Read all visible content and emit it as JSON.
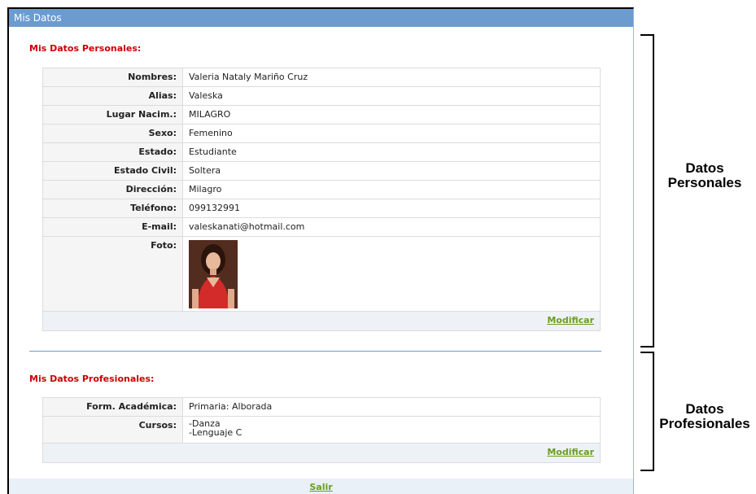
{
  "header": {
    "title": "Mis Datos"
  },
  "personal": {
    "title": "Mis Datos Personales:",
    "rows": [
      {
        "label": "Nombres:",
        "value": "Valeria Nataly Mariño Cruz"
      },
      {
        "label": "Alias:",
        "value": "Valeska"
      },
      {
        "label": "Lugar Nacim.:",
        "value": "MILAGRO"
      },
      {
        "label": "Sexo:",
        "value": "Femenino"
      },
      {
        "label": "Estado:",
        "value": "Estudiante"
      },
      {
        "label": "Estado Civil:",
        "value": "Soltera"
      },
      {
        "label": "Dirección:",
        "value": "Milagro"
      },
      {
        "label": "Teléfono:",
        "value": "099132991"
      },
      {
        "label": "E-mail:",
        "value": "valeskanati@hotmail.com"
      }
    ],
    "photo_label": "Foto:",
    "modify_label": "Modificar"
  },
  "professional": {
    "title": "Mis Datos Profesionales:",
    "rows": [
      {
        "label": "Form. Académica:",
        "value": "Primaria: Alborada"
      }
    ],
    "courses_label": "Cursos:",
    "courses": [
      "-Danza",
      "-Lenguaje C"
    ],
    "modify_label": "Modificar"
  },
  "footer": {
    "exit_label": "Salir"
  },
  "annotations": {
    "personal": [
      "Datos",
      "Personales"
    ],
    "professional": [
      "Datos",
      "Profesionales"
    ]
  },
  "colors": {
    "header_bg": "#6c9bcf",
    "section_title": "#cc0000",
    "link": "#6b9d1f"
  }
}
